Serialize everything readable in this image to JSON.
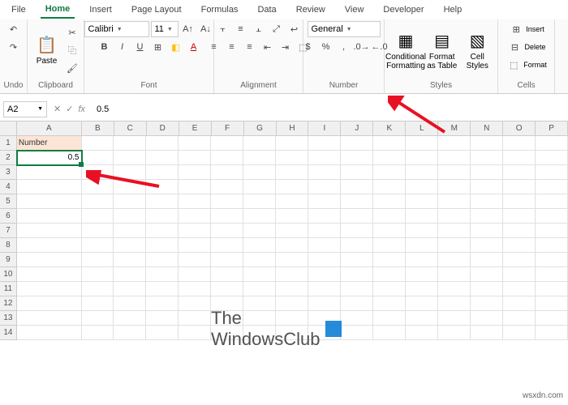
{
  "tabs": [
    "File",
    "Home",
    "Insert",
    "Page Layout",
    "Formulas",
    "Data",
    "Review",
    "View",
    "Developer",
    "Help"
  ],
  "activeTab": "Home",
  "ribbon": {
    "undo": {
      "label": "Undo"
    },
    "clipboard": {
      "label": "Clipboard",
      "paste": "Paste"
    },
    "font": {
      "label": "Font",
      "name": "Calibri",
      "size": "11"
    },
    "alignment": {
      "label": "Alignment"
    },
    "number": {
      "label": "Number",
      "format": "General"
    },
    "styles": {
      "label": "Styles",
      "cond": "Conditional\nFormatting",
      "table": "Format as\nTable",
      "cell": "Cell\nStyles"
    },
    "cells": {
      "label": "Cells",
      "insert": "Insert",
      "delete": "Delete",
      "format": "Format"
    }
  },
  "namebox": "A2",
  "formula": "0.5",
  "columns": [
    "A",
    "B",
    "C",
    "D",
    "E",
    "F",
    "G",
    "H",
    "I",
    "J",
    "K",
    "L",
    "M",
    "N",
    "O",
    "P"
  ],
  "rows": 14,
  "a1": "Number",
  "a2": "0.5",
  "watermark": {
    "line1": "The",
    "line2": "WindowsClub"
  },
  "footer": "wsxdn.com"
}
